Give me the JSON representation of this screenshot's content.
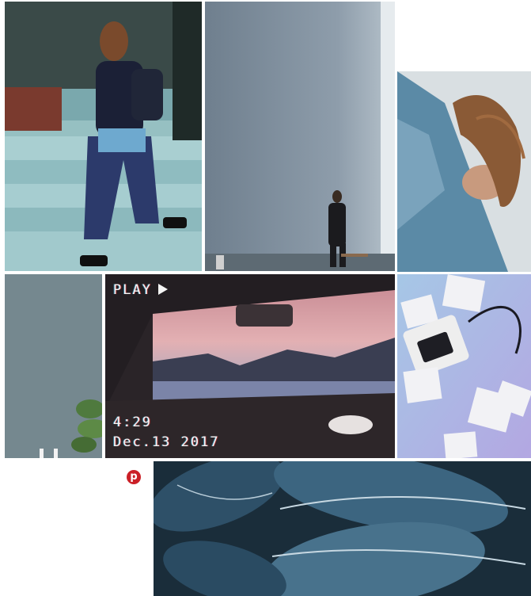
{
  "vhs": {
    "play_label": "PLAY",
    "time": "4:29",
    "date": "Dec.13 2017"
  },
  "pin": {
    "glyph": "p"
  },
  "colors": {
    "pin_red": "#cb2027"
  },
  "icons": [
    "play-icon",
    "pinterest-icon"
  ]
}
